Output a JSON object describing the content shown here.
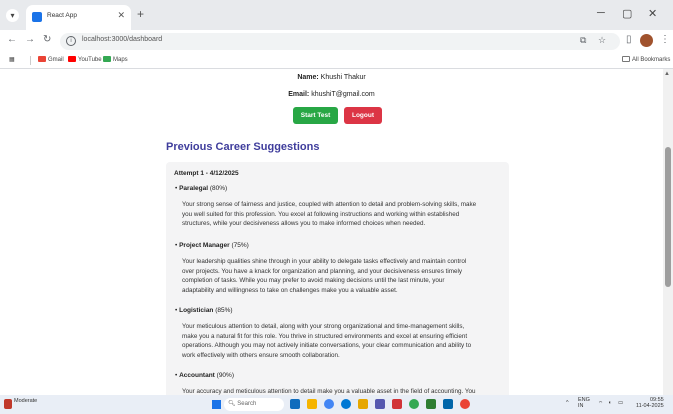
{
  "browser": {
    "tab_title": "React App",
    "url": "localhost:3000/dashboard",
    "bookmarks": [
      {
        "label": "Gmail",
        "color": "#ea4335"
      },
      {
        "label": "YouTube",
        "color": "#ff0000"
      },
      {
        "label": "Maps",
        "color": "#34a853"
      }
    ],
    "all_bookmarks": "All Bookmarks"
  },
  "profile": {
    "name_label": "Name:",
    "name_value": "Khushi Thakur",
    "email_label": "Email:",
    "email_value": "khushiT@gmail.com"
  },
  "actions": {
    "start_label": "Start Test",
    "logout_label": "Logout"
  },
  "history": {
    "title": "Previous Career Suggestions",
    "attempt_label": "Attempt 1 - 4/12/2025",
    "careers": [
      {
        "name": "Paralegal",
        "score": "(80%)",
        "desc_lines": [
          "Your strong sense of fairness and justice, coupled with attention to detail and problem-solving skills, make",
          "you well suited for this profession. You excel at following instructions and working within established",
          "structures, while your decisiveness allows you to make informed choices when needed."
        ]
      },
      {
        "name": "Project Manager",
        "score": "(75%)",
        "desc_lines": [
          "Your leadership qualities shine through in your ability to delegate tasks effectively and maintain control",
          "over projects. You have a knack for organization and planning, and your decisiveness ensures timely",
          "completion of tasks. While you may prefer to avoid making decisions until the last minute, your",
          "adaptability and willingness to take on challenges make you a valuable asset."
        ]
      },
      {
        "name": "Logistician",
        "score": "(85%)",
        "desc_lines": [
          "Your meticulous attention to detail, along with your strong organizational and time-management skills,",
          "make you a natural fit for this role. You thrive in structured environments and excel at ensuring efficient",
          "operations. Although you may not actively initiate conversations, your clear communication and ability to",
          "work effectively with others ensure smooth collaboration."
        ]
      },
      {
        "name": "Accountant",
        "score": "(90%)",
        "desc_lines": [
          "Your accuracy and meticulous attention to detail make you a valuable asset in the field of accounting. You"
        ]
      }
    ]
  },
  "taskbar": {
    "weather": "Moderate",
    "search_placeholder": "Search",
    "lang": "ENG",
    "lang_region": "IN",
    "time": "09:55",
    "date": "11-04-2025"
  },
  "colors": {
    "title": "#3f3d9c",
    "start_button": "#28a745",
    "logout_button": "#dc3545",
    "card_bg": "#f4f4f5"
  }
}
